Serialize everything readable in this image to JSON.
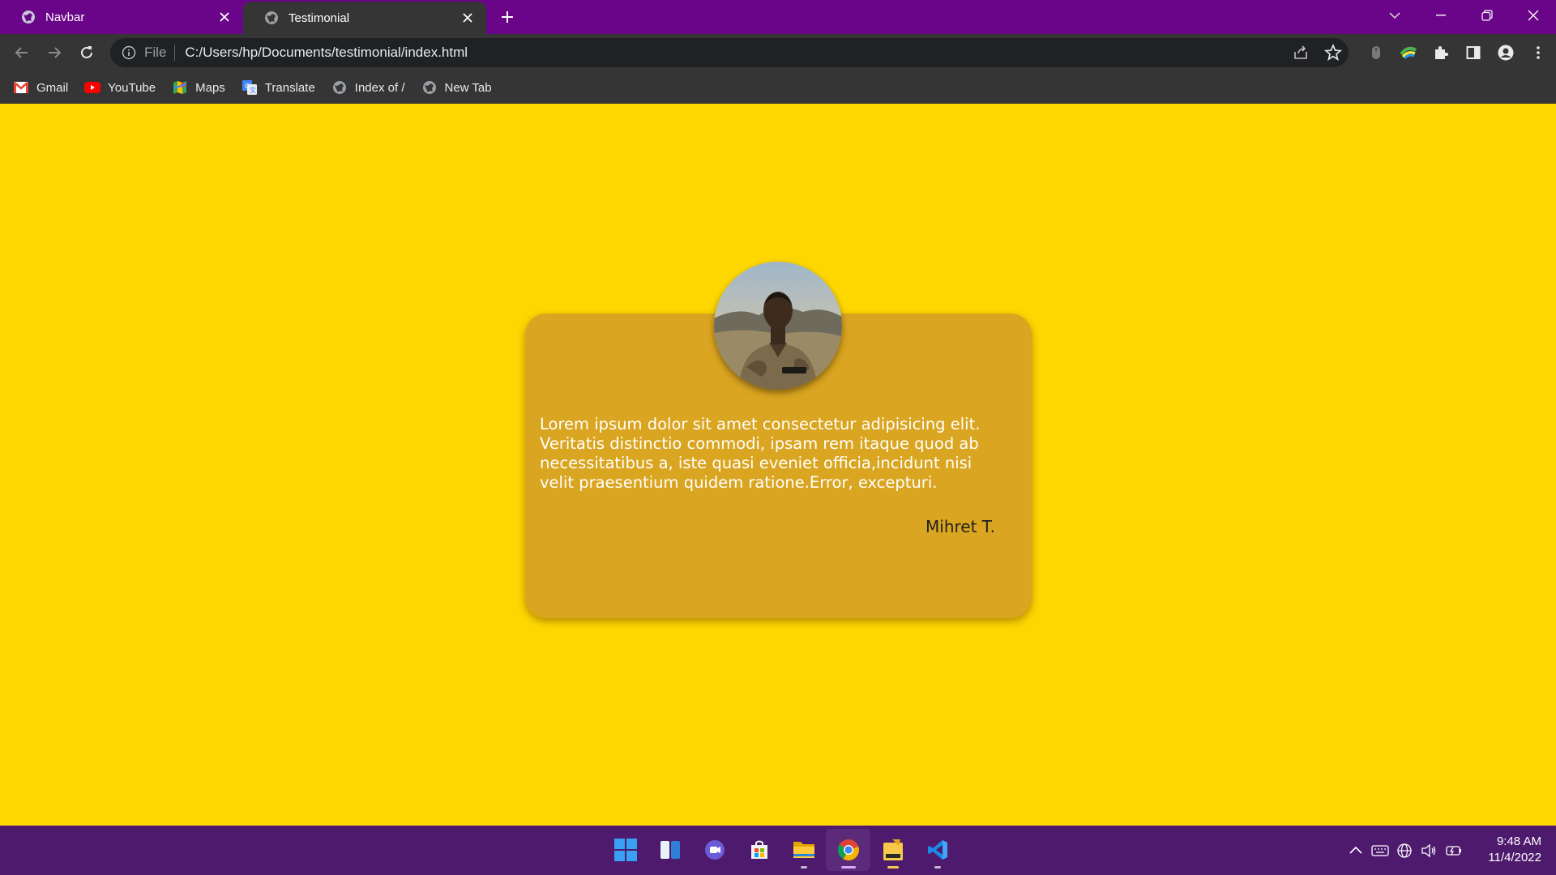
{
  "browser": {
    "tabs": [
      {
        "title": "Navbar",
        "active": false
      },
      {
        "title": "Testimonial",
        "active": true
      }
    ],
    "address": {
      "scheme_label": "File",
      "url": "C:/Users/hp/Documents/testimonial/index.html"
    },
    "bookmarks": [
      {
        "label": "Gmail",
        "icon": "gmail-icon"
      },
      {
        "label": "YouTube",
        "icon": "youtube-icon"
      },
      {
        "label": "Maps",
        "icon": "maps-icon"
      },
      {
        "label": "Translate",
        "icon": "translate-icon"
      },
      {
        "label": "Index of /",
        "icon": "globe-icon"
      },
      {
        "label": "New Tab",
        "icon": "globe-icon"
      }
    ],
    "colors": {
      "tabstrip": "#6a0589",
      "toolbar": "#353535"
    }
  },
  "testimonial": {
    "quote": "Lorem ipsum dolor sit amet consectetur adipisicing elit. Veritatis distinctio commodi, ipsam rem itaque quod ab necessitatibus a, iste quasi eveniet officia,incidunt nisi velit praesentium quidem ratione.Error, excepturi.",
    "author": "Mihret T.",
    "colors": {
      "page_background": "#ffd700",
      "card_background": "#daa520",
      "quote_text": "#ffffff"
    }
  },
  "taskbar": {
    "apps": [
      "start-icon",
      "widgets-icon",
      "teams-chat-icon",
      "store-icon",
      "file-explorer-icon",
      "chrome-icon",
      "player-icon",
      "vscode-icon"
    ],
    "clock": {
      "time": "9:48 AM",
      "date": "11/4/2022"
    },
    "color": "#4e1a6e"
  }
}
